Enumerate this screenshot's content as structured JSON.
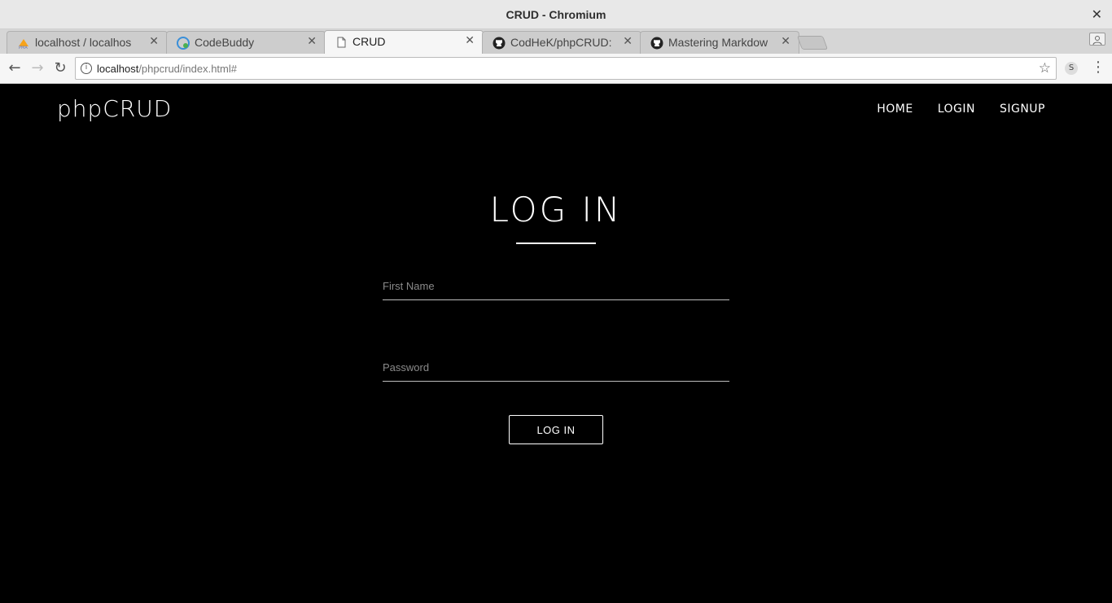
{
  "window": {
    "title": "CRUD - Chromium"
  },
  "tabs": [
    {
      "label": "localhost / localhos",
      "icon": "phpmyadmin-icon",
      "active": false
    },
    {
      "label": "CodeBuddy",
      "icon": "codebuddy-icon",
      "active": false
    },
    {
      "label": "CRUD",
      "icon": "page-icon",
      "active": true
    },
    {
      "label": "CodHeK/phpCRUD:",
      "icon": "github-icon",
      "active": false
    },
    {
      "label": "Mastering Markdow",
      "icon": "github-icon",
      "active": false
    }
  ],
  "address_bar": {
    "host": "localhost",
    "path": "/phpcrud/index.html#"
  },
  "page": {
    "brand": "phpCRUD",
    "nav": {
      "home": "HOME",
      "login": "LOGIN",
      "signup": "SIGNUP"
    },
    "heading": "LOG IN",
    "form": {
      "first_name_placeholder": "First Name",
      "password_placeholder": "Password",
      "submit_label": "LOG IN"
    }
  }
}
